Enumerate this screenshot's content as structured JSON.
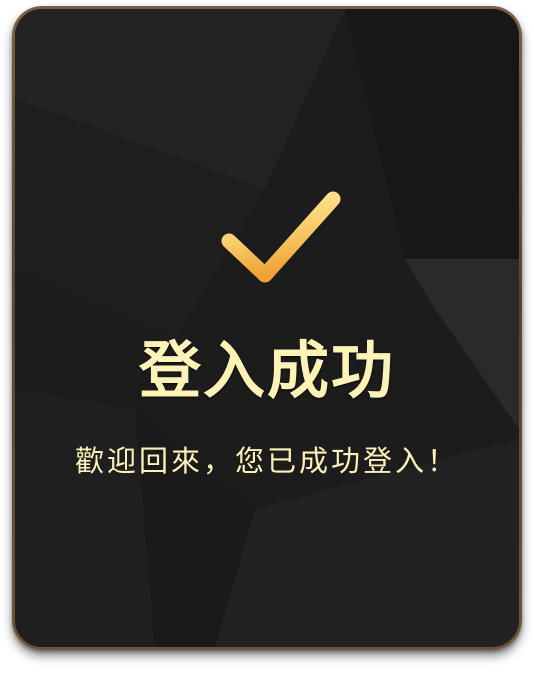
{
  "dialog": {
    "icon": "checkmark-icon",
    "title": "登入成功",
    "message": "歡迎回來，您已成功登入！"
  },
  "colors": {
    "background": "#1c1c1d",
    "frame": "#6b5236",
    "title_text": "#fdf3b6",
    "check_start": "#fde9a0",
    "check_end": "#f2a93a"
  }
}
